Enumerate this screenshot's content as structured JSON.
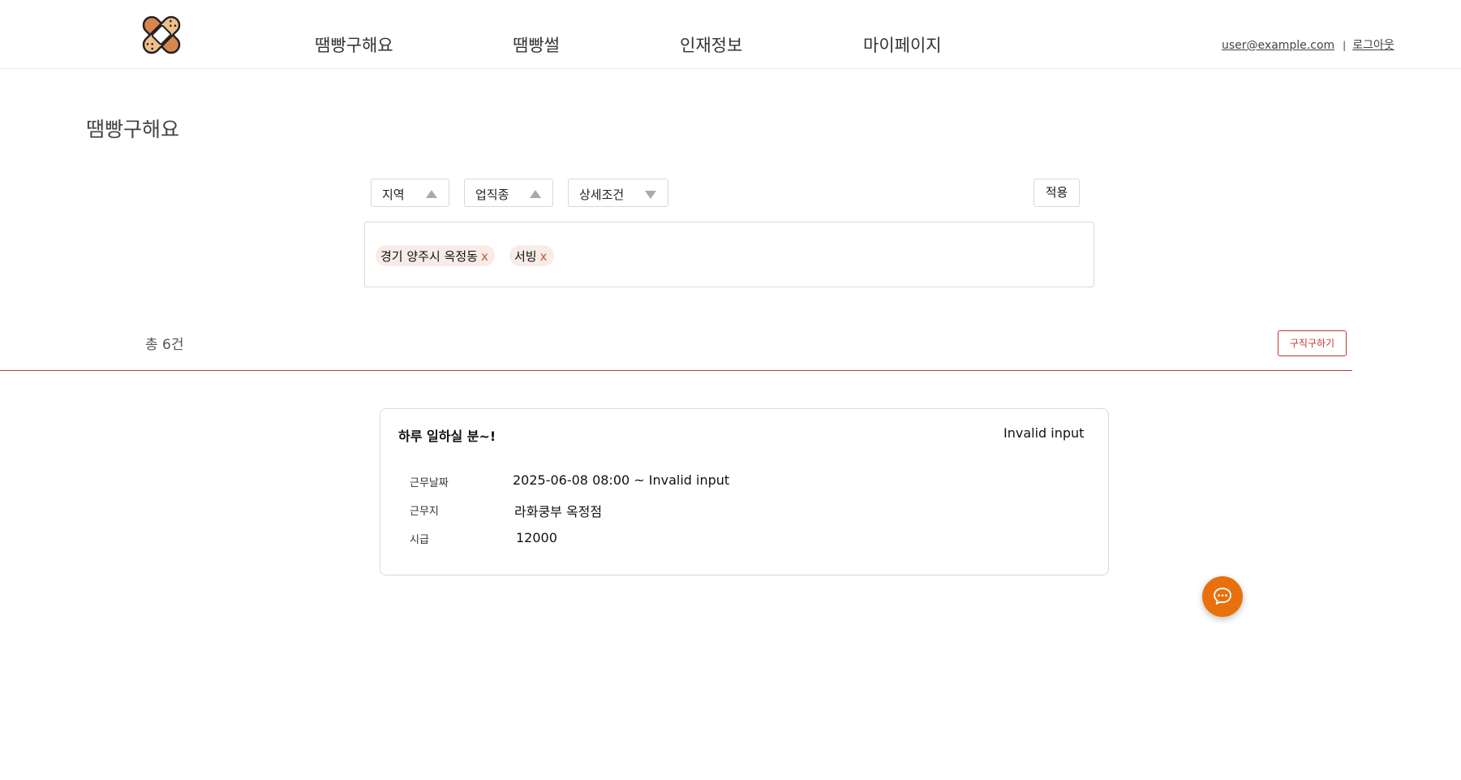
{
  "brand": {
    "logo_icon": "bandage-icon",
    "colors": {
      "accent": "#c0392b",
      "fab": "#e8710e",
      "chip_bg": "#f7ece8"
    }
  },
  "nav": {
    "items": [
      "땜빵구해요",
      "땜빵썰",
      "인재정보",
      "마이페이지"
    ]
  },
  "user": {
    "email": "user@example.com",
    "separator": "|",
    "logout": "로그아웃"
  },
  "page": {
    "title": "땜빵구해요"
  },
  "filters": {
    "region": {
      "label": "지역",
      "icon": "caret-up-icon"
    },
    "job": {
      "label": "업직종",
      "icon": "caret-up-icon"
    },
    "detail": {
      "label": "상세조건",
      "icon": "caret-down-icon"
    },
    "apply_label": "적용"
  },
  "chips": [
    {
      "label": "경기 양주시 옥정동",
      "remove": "x"
    },
    {
      "label": "서빙",
      "remove": "x"
    }
  ],
  "summary": {
    "total_text": "총 6건",
    "seek_button": "구직구하기"
  },
  "posts": [
    {
      "title": "하루 일하실 분~!",
      "status": "Invalid input",
      "rows": [
        {
          "label": "근무날짜",
          "value": "2025-06-08 08:00 ~ Invalid input"
        },
        {
          "label": "근무지",
          "value": "라화쿵부 옥정점"
        },
        {
          "label": "시급",
          "value": "12000"
        }
      ]
    }
  ],
  "fab": {
    "icon": "chat-bubble-icon"
  }
}
